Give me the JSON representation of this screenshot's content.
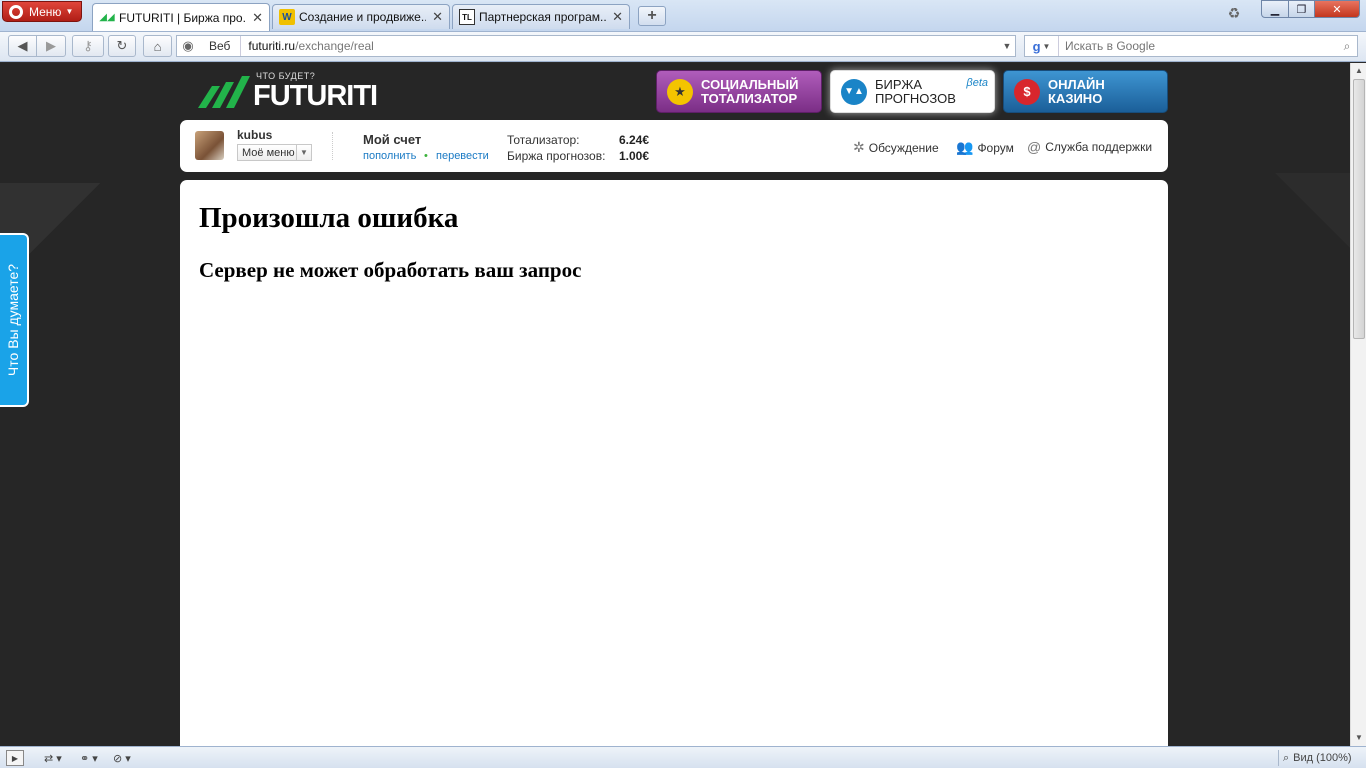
{
  "browser": {
    "menu_label": "Меню",
    "tabs": [
      {
        "title": "FUTURITI | Биржа про...",
        "favicon": "futuriti-logo-icon",
        "active": true
      },
      {
        "title": "Создание и продвиже...",
        "favicon": "W",
        "active": false
      },
      {
        "title": "Партнерская програм...",
        "favicon": "TL",
        "active": false
      }
    ],
    "address": {
      "scheme_label": "Веб",
      "host": "futuriti.ru",
      "path": "/exchange/real"
    },
    "search": {
      "placeholder": "Искать в Google"
    },
    "zoom_label": "Вид (100%)"
  },
  "site": {
    "logo": {
      "tagline": "ЧТО БУДЕТ?",
      "name": "FUTURITI",
      "color": "#22b34a"
    },
    "products": [
      {
        "line1": "Социальный",
        "line2": "тотализатор",
        "icon": "star-icon",
        "color": "#8e3c9a"
      },
      {
        "line1": "Биржа",
        "line2": "прогнозов",
        "icon": "triangles-icon",
        "badge": "βeta",
        "color": "#1a84c7",
        "active": true
      },
      {
        "line1": "Онлайн",
        "line2": "казино",
        "icon": "dollar-chip-icon",
        "color": "#2574b4"
      }
    ],
    "user": {
      "name": "kubus",
      "menu_label": "Моё меню",
      "account_title": "Мой счет",
      "topup_label": "пополнить",
      "transfer_label": "перевести",
      "balances": [
        {
          "label": "Тотализатор:",
          "value": "6.24€"
        },
        {
          "label": "Биржа прогнозов:",
          "value": "1.00€"
        }
      ]
    },
    "links": {
      "discuss": "Обсуждение",
      "forum": "Форум",
      "support": "Служба поддержки"
    },
    "feedback_label": "Что Вы думаете?",
    "error": {
      "title": "Произошла ошибка",
      "message": "Сервер не может обработать ваш запрос"
    }
  }
}
